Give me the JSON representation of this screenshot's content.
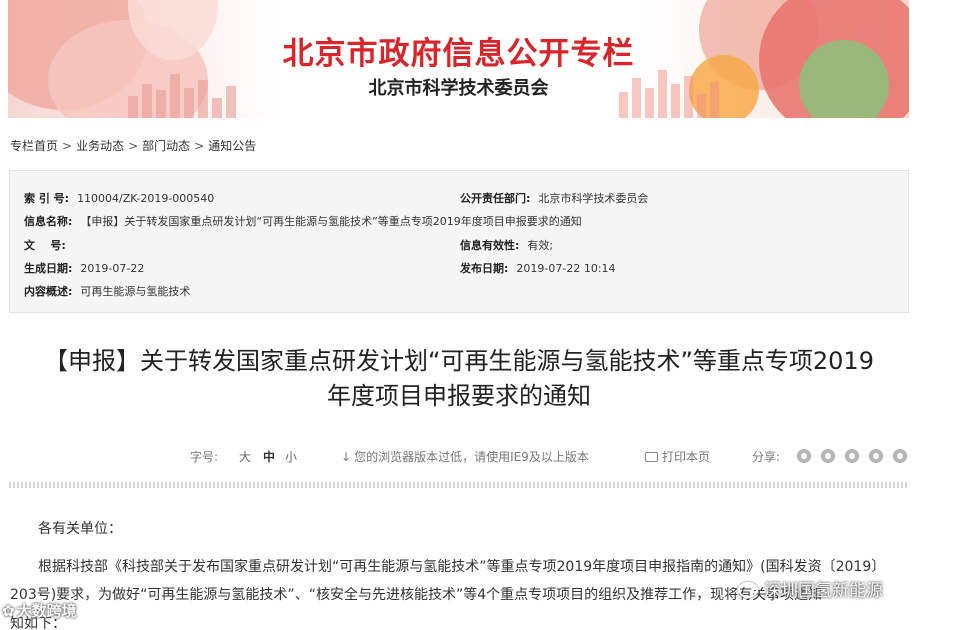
{
  "banner": {
    "title": "北京市政府信息公开专栏",
    "subtitle": "北京市科学技术委员会"
  },
  "breadcrumb": {
    "items": [
      "专栏首页",
      "业务动态",
      "部门动态",
      "通知公告"
    ],
    "separator": ">"
  },
  "info": {
    "index_label": "索 引 号:",
    "index_value": "110004/ZK-2019-000540",
    "dept_label": "公开责任部门:",
    "dept_value": "北京市科学技术委员会",
    "name_label": "信息名称:",
    "name_value": "【申报】关于转发国家重点研发计划“可再生能源与氢能技术”等重点专项2019年度项目申报要求的通知",
    "docno_label": "文    号:",
    "docno_value": "",
    "validity_label": "信息有效性:",
    "validity_value": "有效;",
    "created_label": "生成日期:",
    "created_value": "2019-07-22",
    "published_label": "发布日期:",
    "published_value": "2019-07-22 10:14",
    "summary_label": "内容概述:",
    "summary_value": "可再生能源与氢能技术"
  },
  "article": {
    "title_line1": "【申报】关于转发国家重点研发计划“可再生能源与氢能技术”等重点专项2019",
    "title_line2": "年度项目申报要求的通知"
  },
  "toolbar": {
    "font_size_label": "字号:",
    "font_large": "大",
    "font_medium": "中",
    "font_small": "小",
    "browser_note": "您的浏览器版本过低，请使用IE9及以上版本",
    "print": "打印本页",
    "share_label": "分享:",
    "share_icons": [
      "share-icon-1",
      "share-icon-2",
      "share-icon-3",
      "share-icon-4",
      "share-icon-5"
    ]
  },
  "body": {
    "greeting": "各有关单位：",
    "para1_line1": "根据科技部《科技部关于发布国家重点研发计划“可再生能源与氢能技术”等重点专项2019年度项目申报指南的通知》(国科发资〔2019〕",
    "para1_line2": "203号)要求，为做好“可再生能源与氢能技术”、“核安全与先进核能技术”等4个重点专项项目的组织及推荐工作，现将有关事项通知",
    "para1_line3": "知如下："
  },
  "watermarks": {
    "left": "大数跨境",
    "right": "深圳国氢新能源"
  }
}
